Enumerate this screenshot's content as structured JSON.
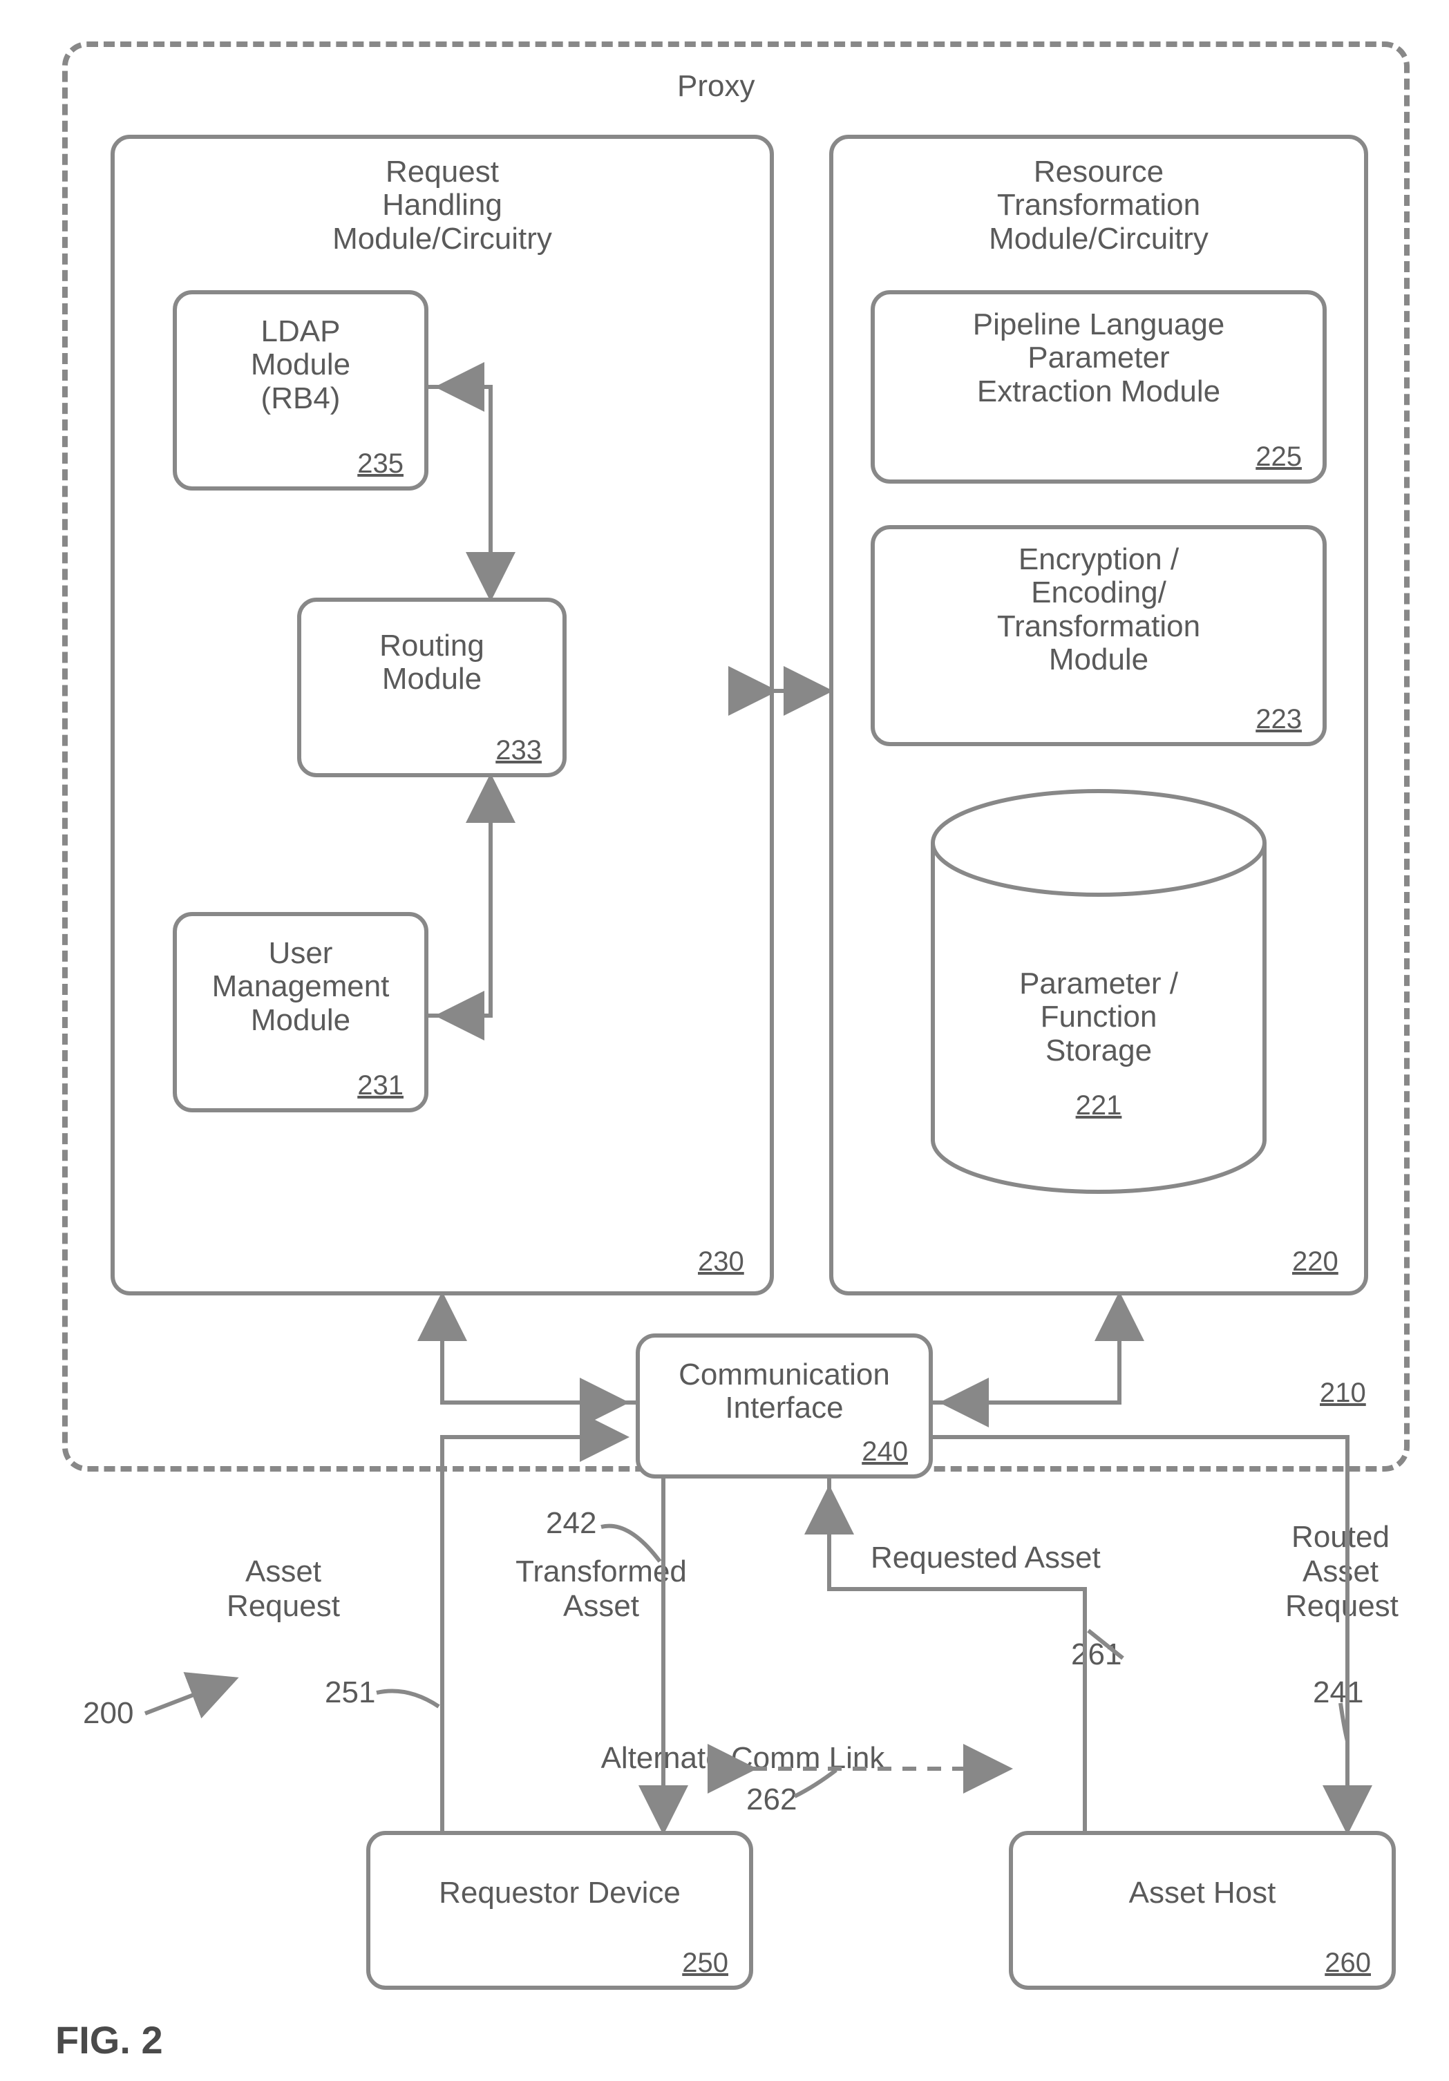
{
  "figure": {
    "caption": "FIG. 2",
    "ref": "200"
  },
  "proxy": {
    "title": "Proxy",
    "num": "210",
    "request_handling": {
      "title1": "Request",
      "title2": "Handling",
      "title3": "Module/Circuitry",
      "num": "230",
      "ldap": {
        "l1": "LDAP",
        "l2": "Module",
        "l3": "(RB4)",
        "num": "235"
      },
      "routing": {
        "l1": "Routing",
        "l2": "Module",
        "num": "233"
      },
      "user": {
        "l1": "User",
        "l2": "Management",
        "l3": "Module",
        "num": "231"
      }
    },
    "resource_transformation": {
      "title1": "Resource",
      "title2": "Transformation",
      "title3": "Module/Circuitry",
      "num": "220",
      "pipeline": {
        "l1": "Pipeline Language",
        "l2": "Parameter",
        "l3": "Extraction Module",
        "num": "225"
      },
      "enc": {
        "l1": "Encryption /",
        "l2": "Encoding/",
        "l3": "Transformation",
        "l4": "Module",
        "num": "223"
      },
      "storage": {
        "l1": "Parameter /",
        "l2": "Function",
        "l3": "Storage",
        "num": "221"
      }
    },
    "comm": {
      "l1": "Communication",
      "l2": "Interface",
      "num": "240"
    }
  },
  "flows": {
    "asset_request": "Asset\nRequest",
    "transformed_asset": "Transformed\nAsset",
    "requested_asset": "Requested Asset",
    "routed_asset_request": "Routed\nAsset\nRequest",
    "alt_link": "Alternate Comm Link",
    "n242": "242",
    "n251": "251",
    "n261": "261",
    "n241": "241",
    "n262": "262"
  },
  "devices": {
    "requestor": {
      "l1": "Requestor Device",
      "num": "250"
    },
    "asset_host": {
      "l1": "Asset Host",
      "num": "260"
    }
  }
}
